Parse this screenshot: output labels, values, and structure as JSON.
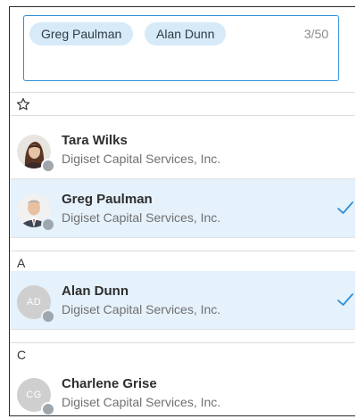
{
  "selector": {
    "chips": [
      "Greg Paulman",
      "Alan Dunn"
    ],
    "counter": "3/50"
  },
  "groups": {
    "favorites": {
      "icon": "star-outline-icon"
    },
    "a": {
      "label": "A"
    },
    "c": {
      "label": "C"
    }
  },
  "people": [
    {
      "name": "Tara Wilks",
      "company": "Digiset Capital Services, Inc.",
      "avatar": "photo",
      "presence": "offline",
      "selected": false
    },
    {
      "name": "Greg Paulman",
      "company": "Digiset Capital Services, Inc.",
      "avatar": "photo",
      "presence": "offline",
      "selected": true
    },
    {
      "name": "Alan Dunn",
      "company": "Digiset Capital Services, Inc.",
      "initials": "AD",
      "presence": "offline",
      "selected": true
    },
    {
      "name": "Charlene Grise",
      "company": "Digiset Capital Services, Inc.",
      "initials": "CG",
      "presence": "offline",
      "selected": false
    }
  ],
  "colors": {
    "accent": "#2f8fd8",
    "chip_bg": "#d6eaf8",
    "selected_row": "#e5f1fb",
    "presence_offline": "#9ea7ad",
    "avatar_placeholder": "#cfcfcf"
  }
}
